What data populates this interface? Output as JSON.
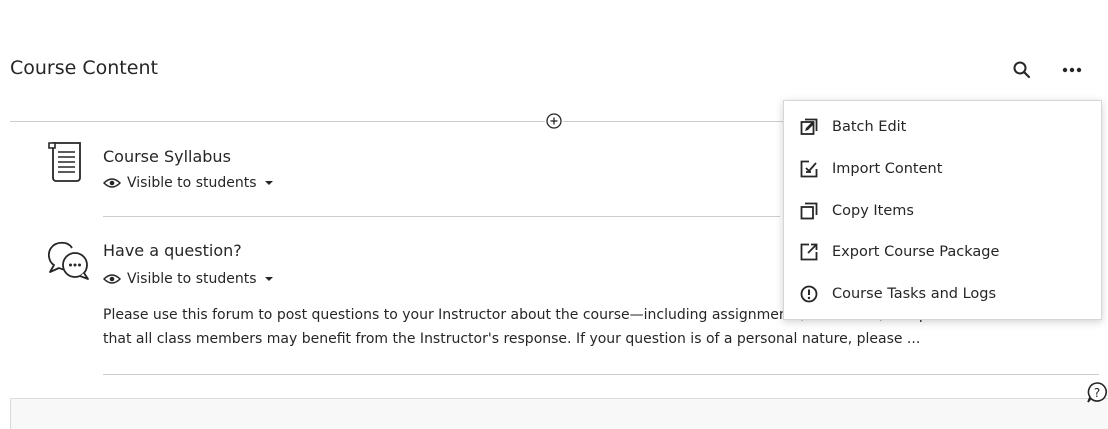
{
  "page": {
    "title": "Course Content"
  },
  "toolbar": {
    "search_icon": "search-icon",
    "more_icon": "more-options-icon"
  },
  "items": [
    {
      "title": "Course Syllabus",
      "icon": "document-icon",
      "visibility": "Visible to students"
    },
    {
      "title": "Have a question?",
      "icon": "discussion-icon",
      "visibility": "Visible to students",
      "description_line1": "Please use this forum to post questions to your Instructor about the course—including assignments, due dates, and procedures—so",
      "description_line2": "that all class members may benefit from the Instructor's response. If your question is of a personal nature, please ..."
    }
  ],
  "menu": {
    "items": [
      {
        "label": "Batch Edit",
        "icon": "batch-edit-icon"
      },
      {
        "label": "Import Content",
        "icon": "import-icon"
      },
      {
        "label": "Copy Items",
        "icon": "copy-icon"
      },
      {
        "label": "Export Course Package",
        "icon": "export-icon"
      },
      {
        "label": "Course Tasks and Logs",
        "icon": "alert-circle-icon"
      }
    ]
  },
  "colors": {
    "text": "#262626",
    "divider": "#cdcdcd",
    "panel": "#f8f8f8"
  }
}
